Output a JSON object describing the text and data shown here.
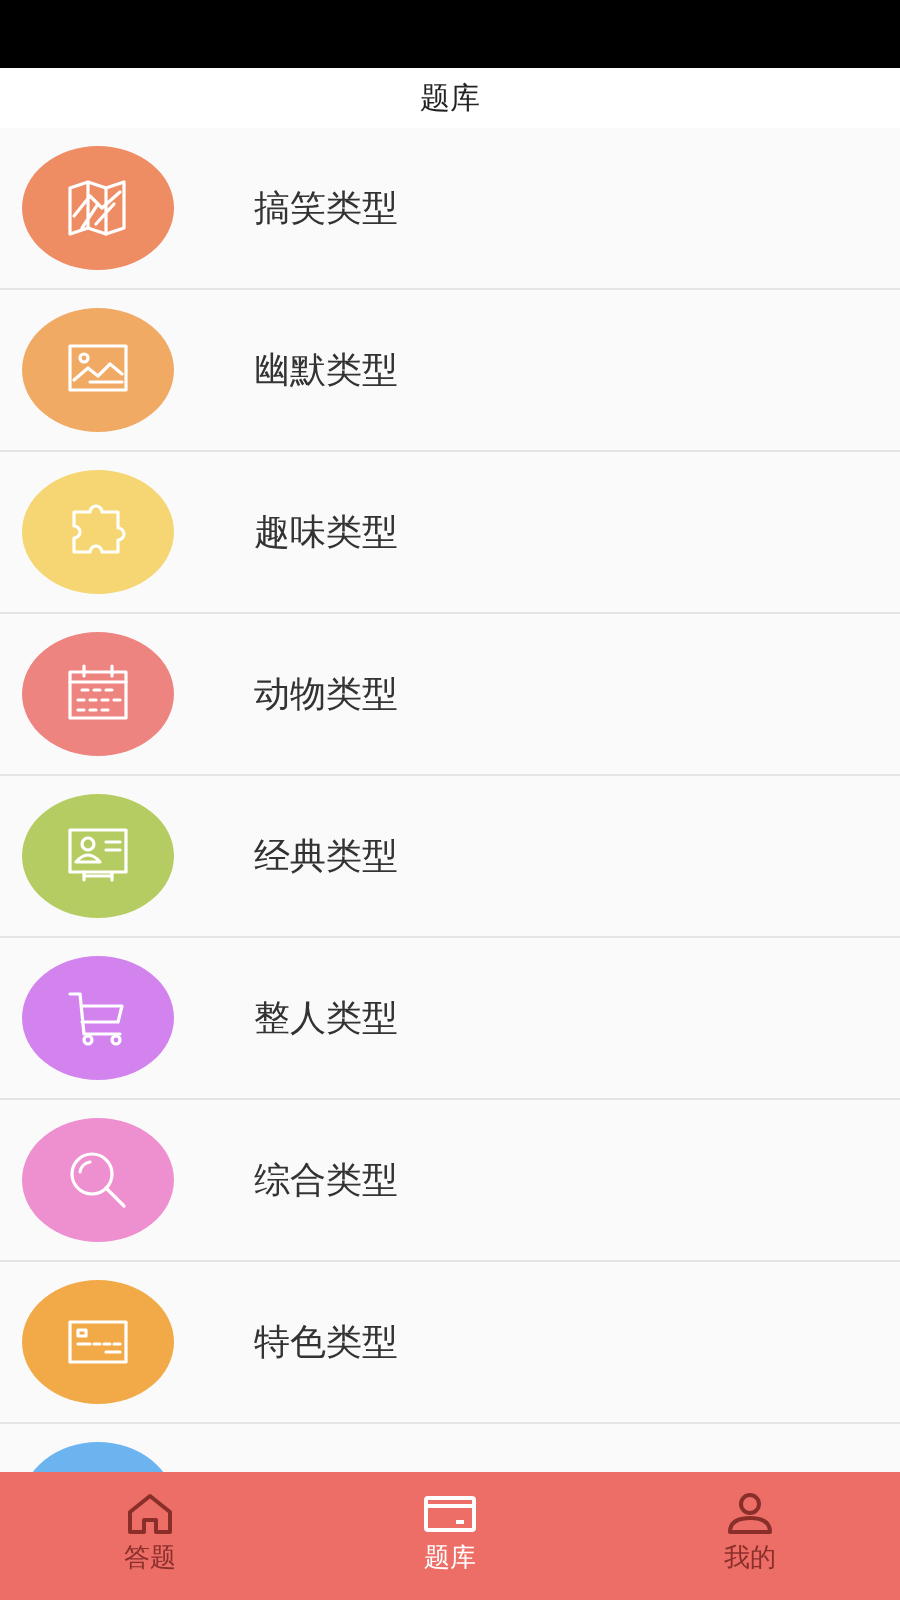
{
  "header": {
    "title": "题库"
  },
  "categories": [
    {
      "label": "搞笑类型",
      "color": "#ee8c64",
      "kind": "map"
    },
    {
      "label": "幽默类型",
      "color": "#f0aa64",
      "kind": "image"
    },
    {
      "label": "趣味类型",
      "color": "#f5d672",
      "kind": "puzzle"
    },
    {
      "label": "动物类型",
      "color": "#ee8480",
      "kind": "calendar"
    },
    {
      "label": "经典类型",
      "color": "#b5cc62",
      "kind": "idcard"
    },
    {
      "label": "整人类型",
      "color": "#d383ee",
      "kind": "cart"
    },
    {
      "label": "综合类型",
      "color": "#ee90d0",
      "kind": "search"
    },
    {
      "label": "特色类型",
      "color": "#f2aa48",
      "kind": "card"
    },
    {
      "color": "#6cb4f0",
      "kind": "none"
    }
  ],
  "tabs": [
    {
      "label": "答题",
      "selected": false,
      "kind": "home"
    },
    {
      "label": "题库",
      "selected": true,
      "kind": "card"
    },
    {
      "label": "我的",
      "selected": false,
      "kind": "user"
    }
  ]
}
